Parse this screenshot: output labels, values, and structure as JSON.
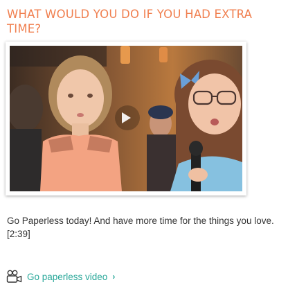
{
  "section": {
    "heading": "WHAT WOULD YOU DO IF YOU HAD EXTRA TIME?"
  },
  "video": {
    "description": "Go Paperless today! And have more time for the things you love. [2:39]",
    "link_label": "Go paperless video",
    "link_chevron": "›"
  },
  "icons": {
    "play": "play-icon",
    "video_camera": "video-camera-icon",
    "chevron": "chevron-right-icon"
  },
  "colors": {
    "heading": "#f07f4f",
    "link": "#2aa89a"
  }
}
